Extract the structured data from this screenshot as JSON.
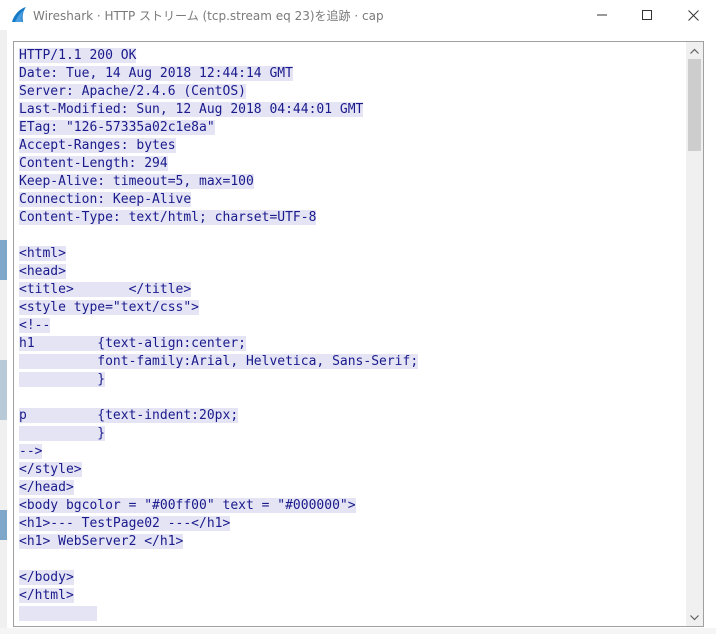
{
  "window": {
    "title": "Wireshark · HTTP ストリーム (tcp.stream eq 23)を追跡 · cap",
    "accent_color": "#1679c6",
    "controls": {
      "minimize_icon": "minimize-icon",
      "maximize_icon": "maximize-icon",
      "close_icon": "close-icon"
    }
  },
  "stream": {
    "text_color": "#1a1a8c",
    "highlight_color": "#e4e4f5",
    "lines": [
      "HTTP/1.1 200 OK",
      "Date: Tue, 14 Aug 2018 12:44:14 GMT",
      "Server: Apache/2.4.6 (CentOS)",
      "Last-Modified: Sun, 12 Aug 2018 04:44:01 GMT",
      "ETag: \"126-57335a02c1e8a\"",
      "Accept-Ranges: bytes",
      "Content-Length: 294",
      "Keep-Alive: timeout=5, max=100",
      "Connection: Keep-Alive",
      "Content-Type: text/html; charset=UTF-8",
      "",
      "<html>",
      "<head>",
      "<title>       </title>",
      "<style type=\"text/css\">",
      "<!--",
      "h1        {text-align:center;",
      "          font-family:Arial, Helvetica, Sans-Serif;",
      "          }",
      "",
      "p         {text-indent:20px;",
      "          }",
      "-->",
      "</style>",
      "</head>",
      "<body bgcolor = \"#00ff00\" text = \"#000000\">",
      "<h1>--- TestPage02 ---</h1>",
      "<h1> WebServer2 </h1>",
      "",
      "</body>",
      "</html>",
      "          "
    ]
  },
  "scrollbar": {
    "up_icon": "chevron-up-icon",
    "down_icon": "chevron-down-icon"
  },
  "footer": {
    "partial_text": ""
  }
}
